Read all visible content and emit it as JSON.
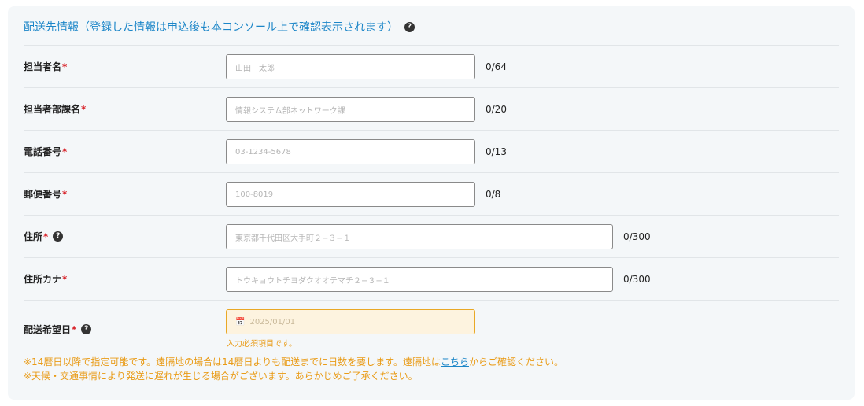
{
  "section": {
    "title": "配送先情報（登録した情報は申込後も本コンソール上で確認表示されます）",
    "help_icon": "question-circle-icon"
  },
  "required_mark": "*",
  "fields": [
    {
      "label": "担当者名",
      "placeholder": "山田　太郎",
      "value": "",
      "counter": "0/64"
    },
    {
      "label": "担当者部課名",
      "placeholder": "情報システム部ネットワーク課",
      "value": "",
      "counter": "0/20"
    },
    {
      "label": "電話番号",
      "placeholder": "03-1234-5678",
      "value": "",
      "counter": "0/13"
    },
    {
      "label": "郵便番号",
      "placeholder": "100-8019",
      "value": "",
      "counter": "0/8"
    },
    {
      "label": "住所",
      "placeholder": "東京都千代田区大手町２−３−１",
      "value": "",
      "counter": "0/300"
    },
    {
      "label": "住所カナ",
      "placeholder": "トウキョウトチヨダクオオテマチ２−３−１",
      "value": "",
      "counter": "0/300"
    }
  ],
  "delivery_date": {
    "label": "配送希望日",
    "placeholder": "2025/01/01",
    "icon": "calendar-icon",
    "error": "入力必須項目です。"
  },
  "notes": {
    "line1_before": "※14暦日以降で指定可能です。遠隔地の場合は14暦日よりも配送までに日数を要します。遠隔地は",
    "line1_link": "こちら",
    "line1_after": "からご確認ください。",
    "line2": "※天候・交通事情により発送に遅れが生じる場合がございます。あらかじめご了承ください。"
  },
  "colors": {
    "title": "#1c86c8",
    "required": "#d8232a",
    "warning": "#e99b16",
    "date_bg": "#fdf3df",
    "link": "#1c86c8"
  }
}
